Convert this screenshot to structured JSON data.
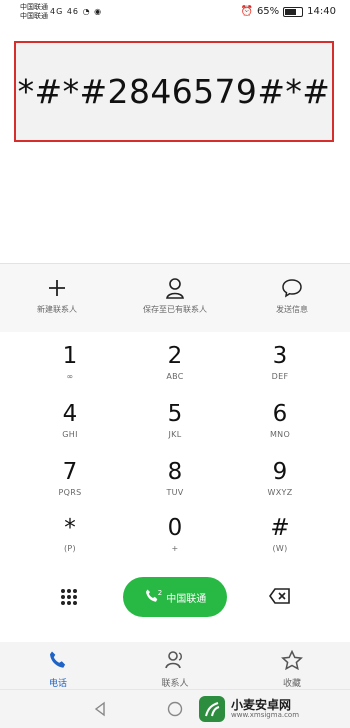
{
  "status_bar": {
    "carrier_line1": "中国联通",
    "carrier_line2": "中国联通",
    "signal_text": "4G 46",
    "battery": "65%",
    "time": "14:40"
  },
  "dial": {
    "number": "*#*#2846579#*#"
  },
  "actions": [
    {
      "label": "新建联系人",
      "icon": "plus-icon"
    },
    {
      "label": "保存至已有联系人",
      "icon": "person-icon"
    },
    {
      "label": "发送信息",
      "icon": "message-icon"
    }
  ],
  "keypad": [
    {
      "digit": "1",
      "letters": "∞"
    },
    {
      "digit": "2",
      "letters": "ABC"
    },
    {
      "digit": "3",
      "letters": "DEF"
    },
    {
      "digit": "4",
      "letters": "GHI"
    },
    {
      "digit": "5",
      "letters": "JKL"
    },
    {
      "digit": "6",
      "letters": "MNO"
    },
    {
      "digit": "7",
      "letters": "PQRS"
    },
    {
      "digit": "8",
      "letters": "TUV"
    },
    {
      "digit": "9",
      "letters": "WXYZ"
    },
    {
      "digit": "*",
      "letters": "(P)"
    },
    {
      "digit": "0",
      "letters": "+"
    },
    {
      "digit": "#",
      "letters": "(W)"
    }
  ],
  "controls": {
    "call_sim": "2",
    "call_label": "中国联通",
    "call_color": "#27b944"
  },
  "tabs": [
    {
      "label": "电话",
      "icon": "phone-icon",
      "active": true
    },
    {
      "label": "联系人",
      "icon": "contacts-icon",
      "active": false
    },
    {
      "label": "收藏",
      "icon": "star-icon",
      "active": false
    }
  ],
  "watermark": {
    "title": "小麦安卓网",
    "url": "www.xmsigma.com"
  },
  "colors": {
    "accent": "#1f63c6",
    "highlight_border": "#d62d2d"
  }
}
